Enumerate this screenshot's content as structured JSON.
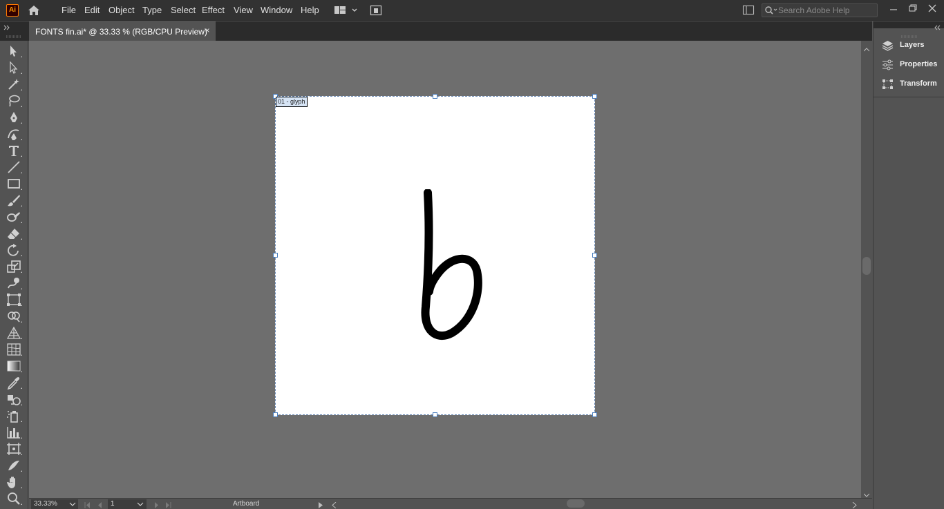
{
  "app": {
    "logo_text": "Ai",
    "brand_color": "#ff9a00"
  },
  "menu": [
    "File",
    "Edit",
    "Object",
    "Type",
    "Select",
    "Effect",
    "View",
    "Window",
    "Help"
  ],
  "search": {
    "placeholder": "Search Adobe Help"
  },
  "document": {
    "tab_title": "FONTS fin.ai* @ 33.33 % (RGB/CPU Preview)",
    "close_glyph": "×"
  },
  "artboard": {
    "label": "01 - glyph",
    "glyph_char": "b",
    "background": "#ffffff"
  },
  "status": {
    "zoom": "33.33%",
    "page": "1",
    "label": "Artboard"
  },
  "panels": [
    {
      "label": "Layers",
      "icon": "layers-icon"
    },
    {
      "label": "Properties",
      "icon": "properties-icon"
    },
    {
      "label": "Transform",
      "icon": "transform-icon"
    }
  ],
  "tools": [
    "selection-tool-icon",
    "direct-selection-tool-icon",
    "magic-wand-tool-icon",
    "lasso-tool-icon",
    "pen-tool-icon",
    "curvature-tool-icon",
    "type-tool-icon",
    "line-segment-tool-icon",
    "rectangle-tool-icon",
    "paintbrush-tool-icon",
    "shaper-tool-icon",
    "eraser-tool-icon",
    "rotate-tool-icon",
    "scale-tool-icon",
    "warp-tool-icon",
    "free-transform-tool-icon",
    "shape-builder-tool-icon",
    "perspective-grid-tool-icon",
    "mesh-tool-icon",
    "gradient-tool-icon",
    "eyedropper-tool-icon",
    "blend-tool-icon",
    "symbol-sprayer-tool-icon",
    "column-graph-tool-icon",
    "artboard-tool-icon",
    "slice-tool-icon",
    "hand-tool-icon",
    "zoom-tool-icon"
  ]
}
